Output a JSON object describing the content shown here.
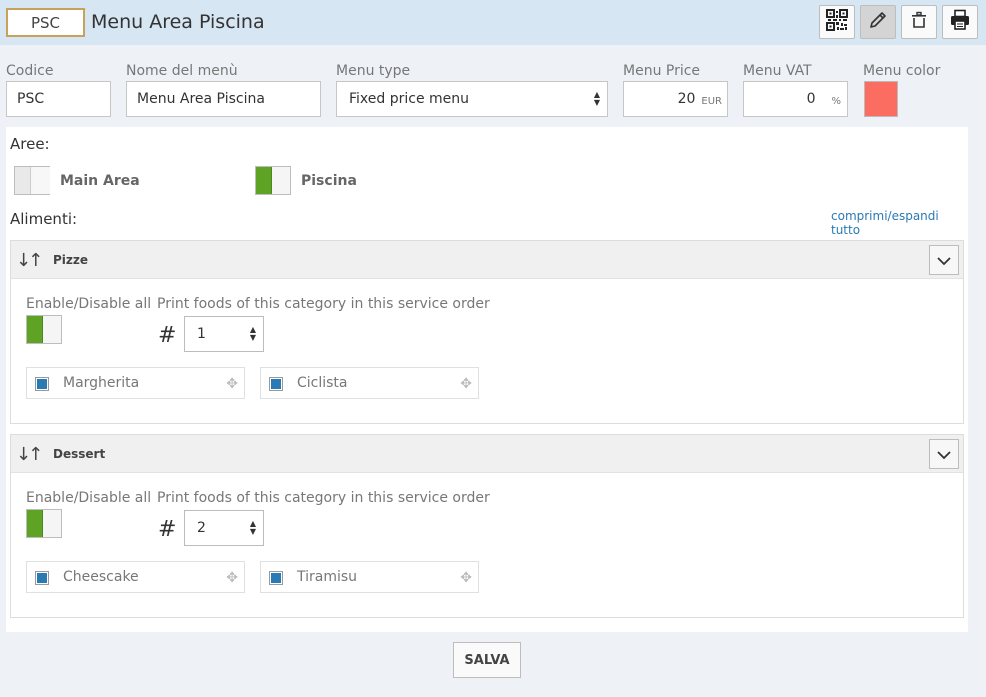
{
  "header": {
    "code": "PSC",
    "title": "Menu Area Piscina",
    "tools": [
      {
        "icon": "qr-code-icon"
      },
      {
        "icon": "pencil-icon"
      },
      {
        "icon": "trash-icon"
      },
      {
        "icon": "printer-icon"
      }
    ]
  },
  "form": {
    "code": {
      "label": "Codice",
      "value": "PSC"
    },
    "name": {
      "label": "Nome del menù",
      "value": "Menu Area Piscina"
    },
    "type": {
      "label": "Menu type",
      "value": "Fixed price menu"
    },
    "price": {
      "label": "Menu Price",
      "value": "20",
      "unit": "EUR"
    },
    "vat": {
      "label": "Menu VAT",
      "value": "0",
      "unit": "%"
    },
    "color": {
      "label": "Menu color",
      "value": "#fb6d61"
    }
  },
  "areas": {
    "label": "Aree:",
    "items": [
      {
        "name": "Main Area",
        "enabled": false
      },
      {
        "name": "Piscina",
        "enabled": true
      }
    ]
  },
  "foods": {
    "label": "Alimenti:",
    "toggle_all_link": "comprimi/espandi tutto",
    "categories": [
      {
        "name": "Pizze",
        "enable_label": "Enable/Disable all",
        "enabled": true,
        "order_label": "Print foods of this category in this service order",
        "order_symbol": "#",
        "order_value": "1",
        "items": [
          "Margherita",
          "Ciclista"
        ]
      },
      {
        "name": "Dessert",
        "enable_label": "Enable/Disable all",
        "enabled": true,
        "order_label": "Print foods of this category in this service order",
        "order_symbol": "#",
        "order_value": "2",
        "items": [
          "Cheescake",
          "Tiramisu"
        ]
      }
    ]
  },
  "actions": {
    "save_label": "SALVA"
  }
}
